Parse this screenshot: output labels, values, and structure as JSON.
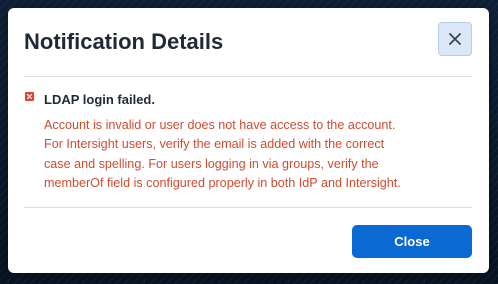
{
  "dialog": {
    "title": "Notification Details",
    "close_icon": "close-icon",
    "close_button_label": "Close"
  },
  "message": {
    "status_icon": "error-icon",
    "status_color": "#d9463a",
    "title": "LDAP login failed.",
    "body_lines": [
      "Account is invalid or user does not have access to the account.",
      "For Intersight users, verify the email is added with the correct",
      "case and spelling. For users logging in via groups, verify the",
      "memberOf field is configured properly in both IdP and Intersight."
    ]
  },
  "colors": {
    "accent": "#0b69d4",
    "error_text": "#d24b2e"
  }
}
